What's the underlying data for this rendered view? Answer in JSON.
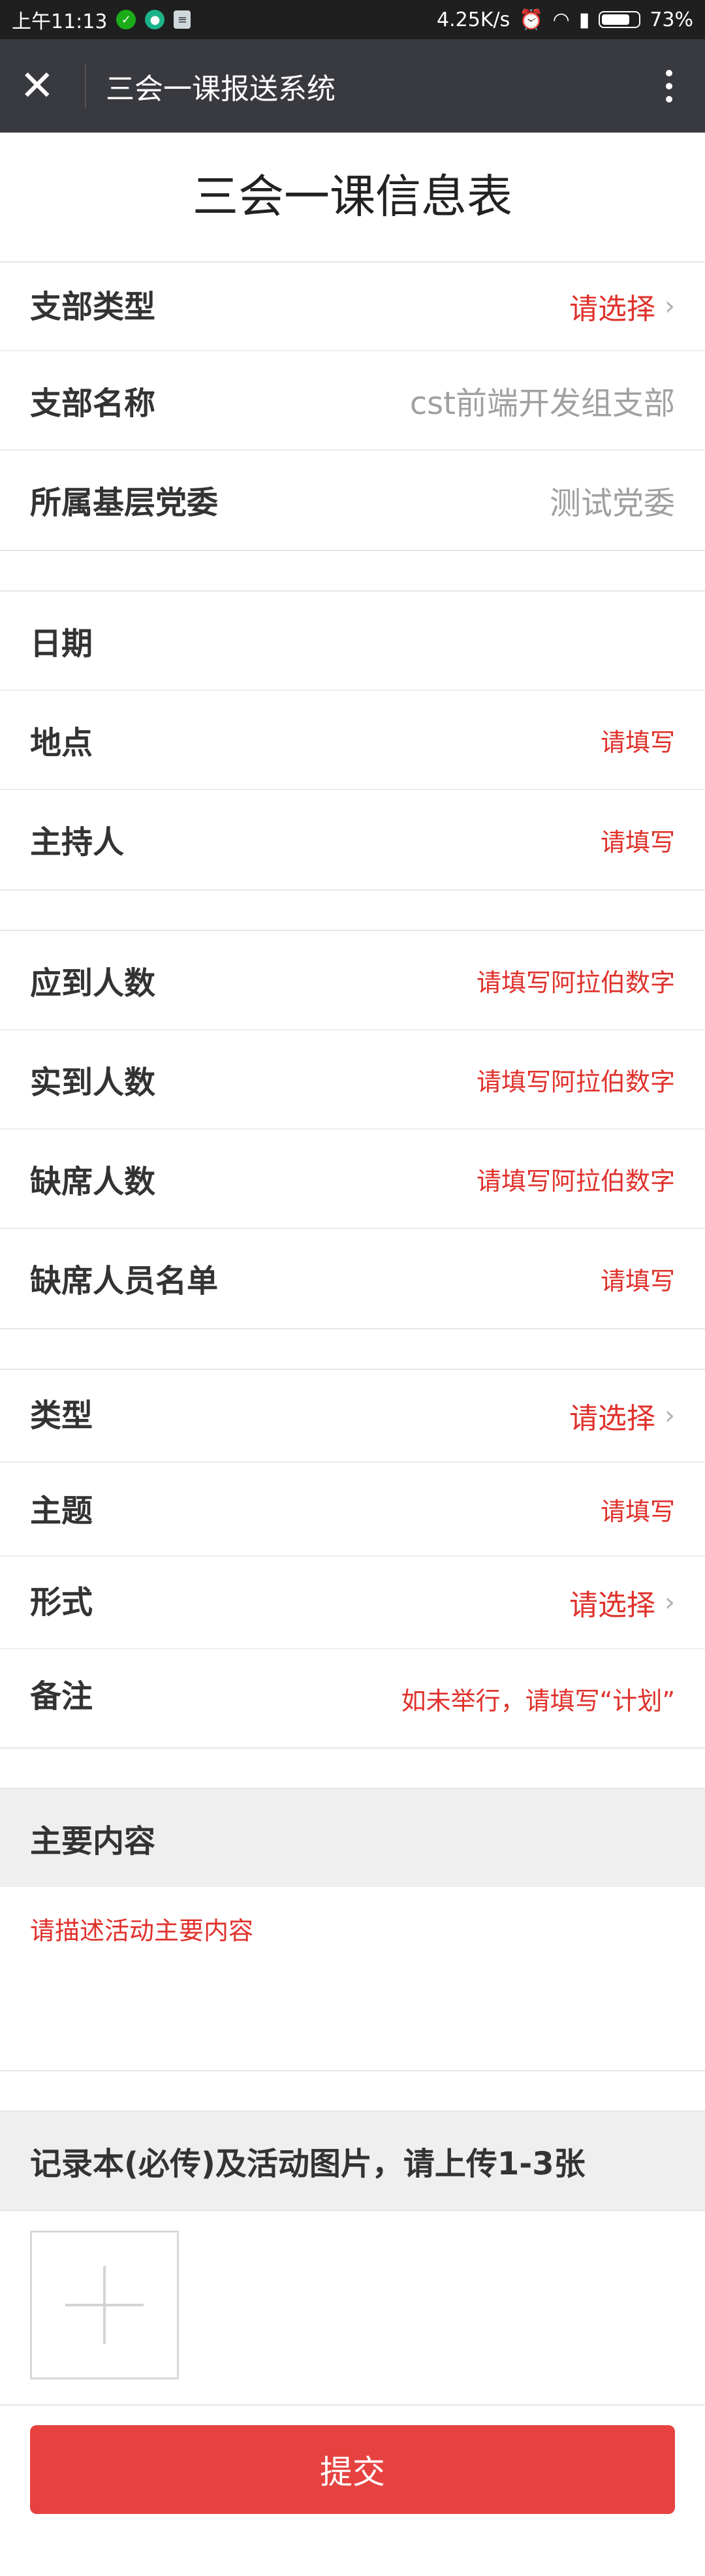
{
  "status_bar": {
    "time": "上午11:13",
    "network_speed": "4.25K/s",
    "battery": "73%",
    "battery_level_fraction": 0.73
  },
  "nav": {
    "title": "三会一课报送系统",
    "close_icon": "close-icon",
    "more_icon": "more-vertical-icon"
  },
  "page": {
    "title": "三会一课信息表"
  },
  "form": {
    "branch_type": {
      "label": "支部类型",
      "value": "请选择"
    },
    "branch_name": {
      "label": "支部名称",
      "value": "cst前端开发组支部"
    },
    "party_committee": {
      "label": "所属基层党委",
      "value": "测试党委"
    },
    "date": {
      "label": "日期",
      "value": ""
    },
    "location": {
      "label": "地点",
      "placeholder": "请填写"
    },
    "host": {
      "label": "主持人",
      "placeholder": "请填写"
    },
    "expected_count": {
      "label": "应到人数",
      "placeholder": "请填写阿拉伯数字"
    },
    "actual_count": {
      "label": "实到人数",
      "placeholder": "请填写阿拉伯数字"
    },
    "absent_count": {
      "label": "缺席人数",
      "placeholder": "请填写阿拉伯数字"
    },
    "absent_list": {
      "label": "缺席人员名单",
      "placeholder": "请填写"
    },
    "type": {
      "label": "类型",
      "value": "请选择"
    },
    "topic": {
      "label": "主题",
      "placeholder": "请填写"
    },
    "format": {
      "label": "形式",
      "value": "请选择"
    },
    "note": {
      "label": "备注",
      "placeholder": "如未举行，请填写“计划”"
    }
  },
  "main_content": {
    "heading": "主要内容",
    "placeholder": "请描述活动主要内容"
  },
  "upload": {
    "heading": "记录本(必传)及活动图片，请上传1-3张"
  },
  "submit": {
    "label": "提交"
  },
  "colors": {
    "accent": "#e64340",
    "placeholder_red": "#e0312b",
    "nav_bg": "#393a3f"
  }
}
